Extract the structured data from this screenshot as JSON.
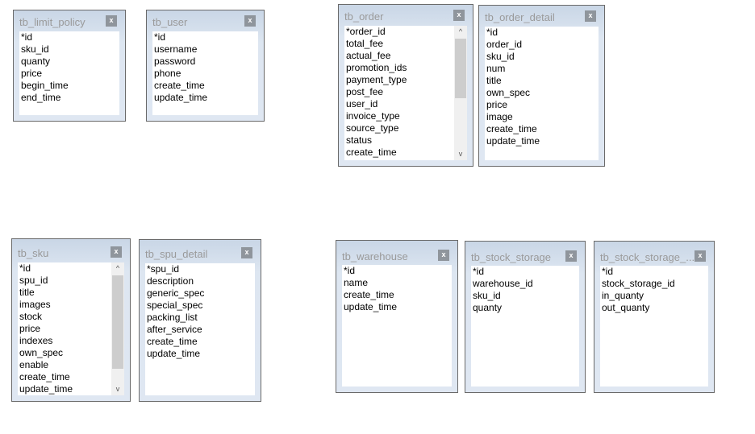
{
  "close_label": "x",
  "scroll_up": "^",
  "scroll_down": "v",
  "tables": [
    {
      "name": "tb_limit_policy",
      "fields": [
        "*id",
        "sku_id",
        "quanty",
        "price",
        "begin_time",
        "end_time"
      ],
      "scroll": null
    },
    {
      "name": "tb_user",
      "fields": [
        "*id",
        "username",
        "password",
        "phone",
        "create_time",
        "update_time"
      ],
      "scroll": null
    },
    {
      "name": "tb_order",
      "fields": [
        "*order_id",
        "total_fee",
        "actual_fee",
        "promotion_ids",
        "payment_type",
        "post_fee",
        "user_id",
        "invoice_type",
        "source_type",
        "status",
        "create_time"
      ],
      "scroll": {
        "thumb_fraction": 0.55
      }
    },
    {
      "name": "tb_order_detail",
      "fields": [
        "*id",
        "order_id",
        "sku_id",
        "num",
        "title",
        "own_spec",
        "price",
        "image",
        "create_time",
        "update_time"
      ],
      "scroll": null
    },
    {
      "name": "tb_sku",
      "fields": [
        "*id",
        "spu_id",
        "title",
        "images",
        "stock",
        "price",
        "indexes",
        "own_spec",
        "enable",
        "create_time",
        "update_time"
      ],
      "scroll": {
        "thumb_fraction": 0.87
      }
    },
    {
      "name": "tb_spu_detail",
      "fields": [
        "*spu_id",
        "description",
        "generic_spec",
        "special_spec",
        "packing_list",
        "after_service",
        "create_time",
        "update_time"
      ],
      "scroll": null
    },
    {
      "name": "tb_warehouse",
      "fields": [
        "*id",
        "name",
        "create_time",
        "update_time"
      ],
      "scroll": null
    },
    {
      "name": "tb_stock_storage",
      "fields": [
        "*id",
        "warehouse_id",
        "sku_id",
        "quanty"
      ],
      "scroll": null
    },
    {
      "name": "tb_stock_storage_...",
      "fields": [
        "*id",
        "stock_storage_id",
        "in_quanty",
        "out_quanty"
      ],
      "scroll": null
    }
  ]
}
